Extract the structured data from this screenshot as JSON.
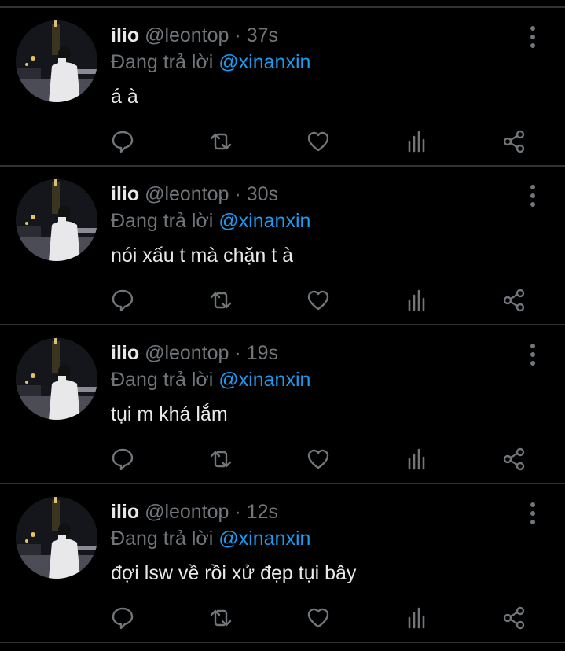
{
  "colors": {
    "background": "#000000",
    "text": "#e7e9ea",
    "muted": "#71767b",
    "mention": "#1d9bf0",
    "divider": "#2f3336"
  },
  "icons": [
    "more-vertical-icon",
    "reply-icon",
    "retweet-icon",
    "like-icon",
    "analytics-icon",
    "share-icon"
  ],
  "tweets": [
    {
      "name": "ilio",
      "handle": "@leontop",
      "sep": "·",
      "time": "37s",
      "replying_prefix": "Đang trả lời",
      "mention": "@xinanxin",
      "text": "á à"
    },
    {
      "name": "ilio",
      "handle": "@leontop",
      "sep": "·",
      "time": "30s",
      "replying_prefix": "Đang trả lời",
      "mention": "@xinanxin",
      "text": "nói xấu t mà chặn t à"
    },
    {
      "name": "ilio",
      "handle": "@leontop",
      "sep": "·",
      "time": "19s",
      "replying_prefix": "Đang trả lời",
      "mention": "@xinanxin",
      "text": "tụi m khá lắm"
    },
    {
      "name": "ilio",
      "handle": "@leontop",
      "sep": "·",
      "time": "12s",
      "replying_prefix": "Đang trả lời",
      "mention": "@xinanxin",
      "text": "đợi lsw về rồi xử đẹp tụi bây"
    }
  ]
}
